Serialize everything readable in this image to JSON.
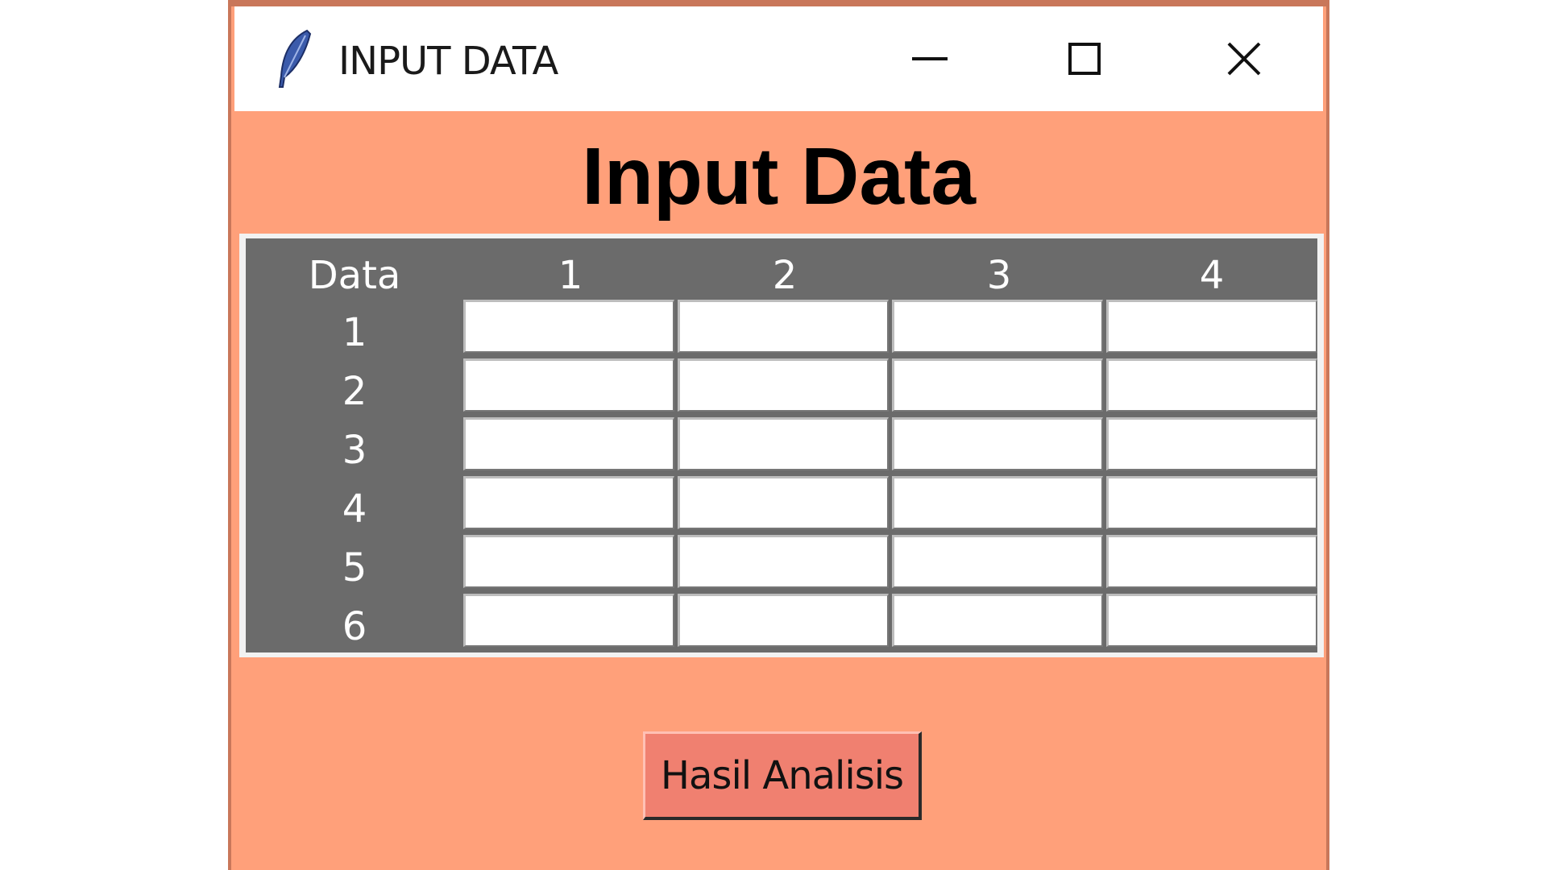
{
  "window": {
    "title": "INPUT DATA",
    "app_icon": "feather-icon",
    "controls": {
      "minimize_icon": "minimize-icon",
      "maximize_icon": "maximize-icon",
      "close_icon": "close-icon"
    }
  },
  "heading": "Input Data",
  "table": {
    "corner_label": "Data",
    "column_headers": [
      "1",
      "2",
      "3",
      "4"
    ],
    "row_labels": [
      "1",
      "2",
      "3",
      "4",
      "5",
      "6"
    ],
    "values": [
      [
        "",
        "",
        "",
        ""
      ],
      [
        "",
        "",
        "",
        ""
      ],
      [
        "",
        "",
        "",
        ""
      ],
      [
        "",
        "",
        "",
        ""
      ],
      [
        "",
        "",
        "",
        ""
      ],
      [
        "",
        "",
        "",
        ""
      ]
    ]
  },
  "button": {
    "label": "Hasil Analisis"
  },
  "colors": {
    "window_background": "#ffa07a",
    "grid_header_background": "#6b6b6b",
    "button_background": "#f08070"
  }
}
